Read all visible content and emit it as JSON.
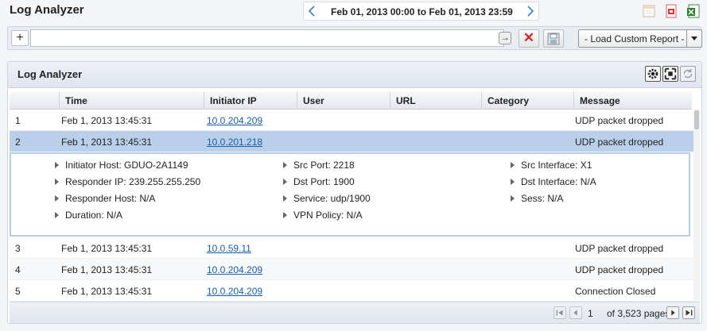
{
  "app": {
    "title": "Log Analyzer"
  },
  "date_nav": {
    "range": "Feb 01, 2013 00:00 to Feb 01, 2013 23:59"
  },
  "top_icons": [
    "calendar-icon",
    "pdf-export-icon",
    "excel-export-icon"
  ],
  "filter": {
    "add_label": "+",
    "value": "",
    "go_label": "→",
    "clear_label": "✕"
  },
  "report_select": {
    "selected": "- Load Custom Report -"
  },
  "panel": {
    "title": "Log Analyzer"
  },
  "table": {
    "columns": [
      "",
      "Time",
      "Initiator IP",
      "User",
      "URL",
      "Category",
      "Message"
    ],
    "rows": [
      {
        "num": "1",
        "time": "Feb 1, 2013 13:45:31",
        "ip": "10.0.204.209",
        "message": "UDP packet dropped"
      },
      {
        "num": "2",
        "time": "Feb 1, 2013 13:45:31",
        "ip": "10.0.201.218",
        "message": "UDP packet dropped"
      },
      {
        "num": "3",
        "time": "Feb 1, 2013 13:45:31",
        "ip": "10.0.59.11",
        "message": "UDP packet dropped"
      },
      {
        "num": "4",
        "time": "Feb 1, 2013 13:45:31",
        "ip": "10.0.204.209",
        "message": "UDP packet dropped"
      },
      {
        "num": "5",
        "time": "Feb 1, 2013 13:45:31",
        "ip": "10.0.204.209",
        "message": "Connection Closed"
      }
    ],
    "detail": {
      "col1": [
        "Initiator Host: GDUO-2A1149",
        "Responder IP: 239.255.255.250",
        "Responder Host: N/A",
        "Duration: N/A"
      ],
      "col2": [
        "Src Port: 2218",
        "Dst Port: 1900",
        "Service: udp/1900",
        "VPN Policy: N/A"
      ],
      "col3": [
        "Src Interface: X1",
        "Dst Interface: N/A",
        "Sess: N/A"
      ]
    }
  },
  "pager": {
    "page": "1",
    "total": "of 3,523 pages"
  },
  "colors": {
    "selected_row": "#b9cfea",
    "link": "#1a5fa8",
    "clear_red": "#d1262a"
  }
}
